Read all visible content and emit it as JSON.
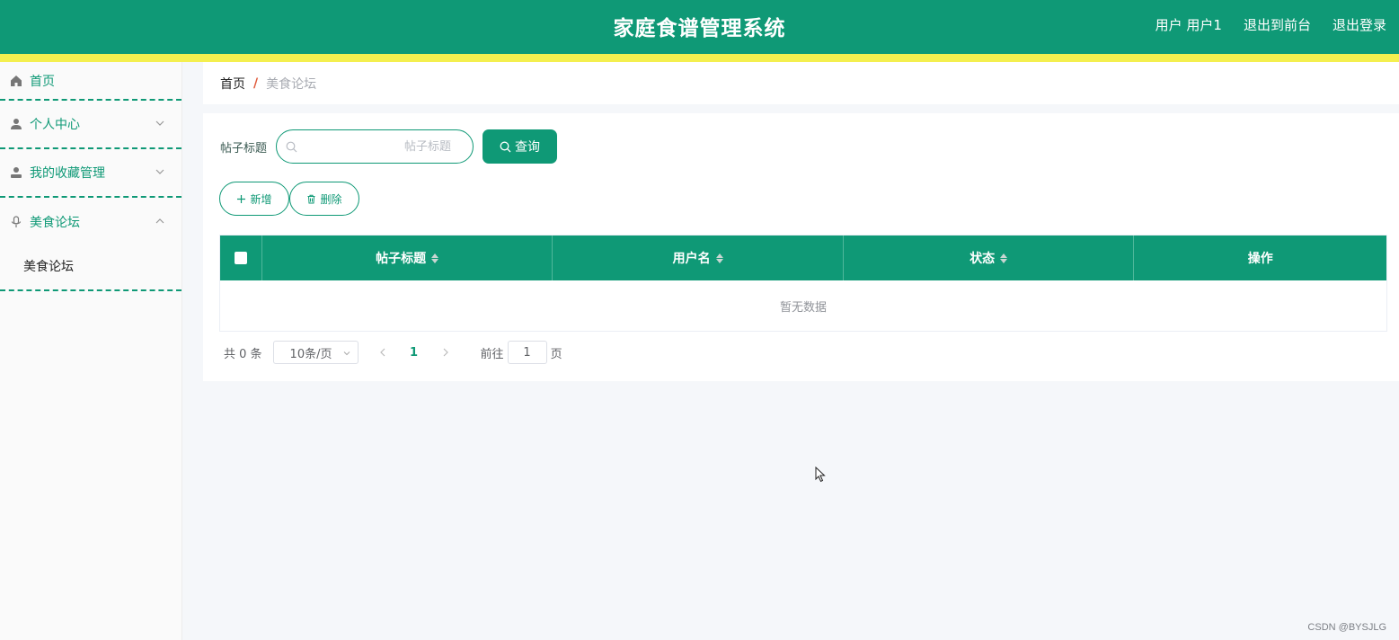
{
  "header": {
    "title": "家庭食谱管理系统",
    "user_label": "用户 用户1",
    "front_link": "退出到前台",
    "logout_link": "退出登录"
  },
  "sidebar": {
    "items": [
      {
        "label": "首页",
        "icon": "home-icon"
      },
      {
        "label": "个人中心",
        "icon": "user-icon"
      },
      {
        "label": "我的收藏管理",
        "icon": "collection-user-icon"
      },
      {
        "label": "美食论坛",
        "icon": "microphone-icon",
        "expanded": true,
        "children": [
          {
            "label": "美食论坛"
          }
        ]
      }
    ]
  },
  "breadcrumb": {
    "home": "首页",
    "separator": "/",
    "current": "美食论坛"
  },
  "search": {
    "label": "帖子标题",
    "placeholder": "帖子标题",
    "value": "",
    "button_label": "查询"
  },
  "actions": {
    "add_label": "新增",
    "delete_label": "删除"
  },
  "table": {
    "columns": [
      "帖子标题",
      "用户名",
      "状态",
      "操作"
    ],
    "rows": [],
    "empty_text": "暂无数据"
  },
  "pagination": {
    "total_text": "共 0 条",
    "page_size": "10条/页",
    "current_page": "1",
    "goto_label": "前往",
    "goto_value": "1",
    "page_suffix": "页"
  },
  "watermark": "CSDN @BYSJLG",
  "colors": {
    "primary": "#0f9976",
    "stripe": "#f4ef4f",
    "separator": "#e05b3c"
  }
}
